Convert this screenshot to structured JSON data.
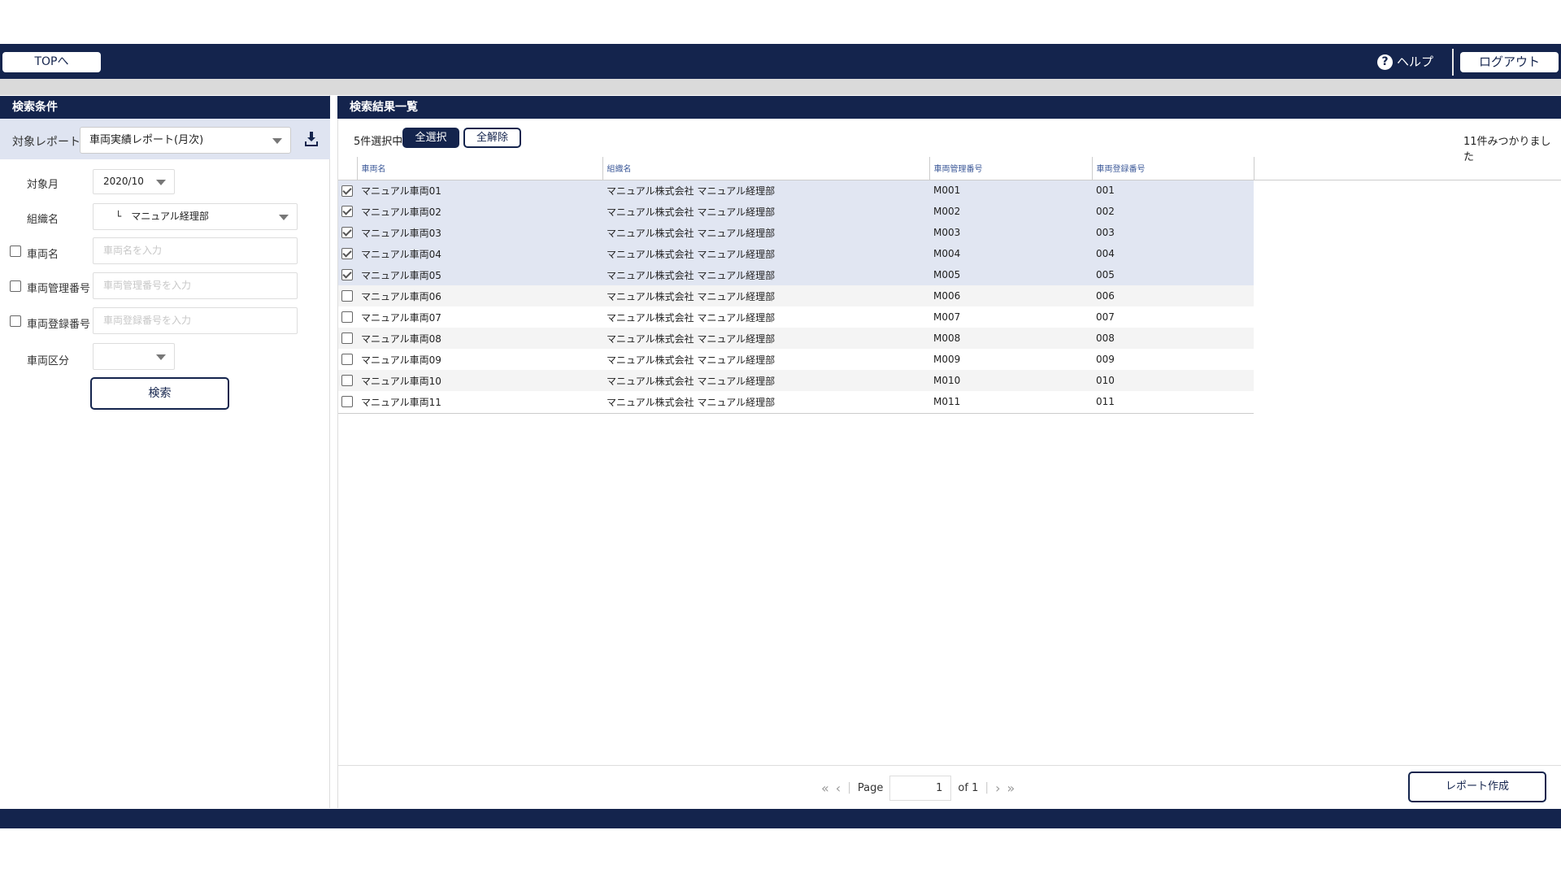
{
  "header": {
    "top_label": "TOPへ",
    "help_label": "ヘルプ",
    "logout_label": "ログアウト"
  },
  "search_panel": {
    "title": "検索条件",
    "report_label": "対象レポート",
    "report_value": "車両実績レポート(月次)",
    "month_label": "対象月",
    "month_value": "2020/10",
    "org_label": "組織名",
    "org_value": "└　マニュアル経理部",
    "vehicle_name_label": "車両名",
    "vehicle_name_placeholder": "車両名を入力",
    "mgmt_no_label": "車両管理番号",
    "mgmt_no_placeholder": "車両管理番号を入力",
    "reg_no_label": "車両登録番号",
    "reg_no_placeholder": "車両登録番号を入力",
    "category_label": "車両区分",
    "category_value": "",
    "search_button": "検索"
  },
  "results": {
    "title": "検索結果一覧",
    "selection_count": "5件選択中",
    "select_all": "全選択",
    "clear_all": "全解除",
    "found_count": "11件みつかりました",
    "columns": [
      "車両名",
      "組織名",
      "車両管理番号",
      "車両登録番号"
    ],
    "rows": [
      {
        "checked": true,
        "name": "マニュアル車両01",
        "org": "マニュアル株式会社 マニュアル経理部",
        "mgmt": "M001",
        "reg": "001"
      },
      {
        "checked": true,
        "name": "マニュアル車両02",
        "org": "マニュアル株式会社 マニュアル経理部",
        "mgmt": "M002",
        "reg": "002"
      },
      {
        "checked": true,
        "name": "マニュアル車両03",
        "org": "マニュアル株式会社 マニュアル経理部",
        "mgmt": "M003",
        "reg": "003"
      },
      {
        "checked": true,
        "name": "マニュアル車両04",
        "org": "マニュアル株式会社 マニュアル経理部",
        "mgmt": "M004",
        "reg": "004"
      },
      {
        "checked": true,
        "name": "マニュアル車両05",
        "org": "マニュアル株式会社 マニュアル経理部",
        "mgmt": "M005",
        "reg": "005"
      },
      {
        "checked": false,
        "name": "マニュアル車両06",
        "org": "マニュアル株式会社 マニュアル経理部",
        "mgmt": "M006",
        "reg": "006"
      },
      {
        "checked": false,
        "name": "マニュアル車両07",
        "org": "マニュアル株式会社 マニュアル経理部",
        "mgmt": "M007",
        "reg": "007"
      },
      {
        "checked": false,
        "name": "マニュアル車両08",
        "org": "マニュアル株式会社 マニュアル経理部",
        "mgmt": "M008",
        "reg": "008"
      },
      {
        "checked": false,
        "name": "マニュアル車両09",
        "org": "マニュアル株式会社 マニュアル経理部",
        "mgmt": "M009",
        "reg": "009"
      },
      {
        "checked": false,
        "name": "マニュアル車両10",
        "org": "マニュアル株式会社 マニュアル経理部",
        "mgmt": "M010",
        "reg": "010"
      },
      {
        "checked": false,
        "name": "マニュアル車両11",
        "org": "マニュアル株式会社 マニュアル経理部",
        "mgmt": "M011",
        "reg": "011"
      }
    ]
  },
  "pager": {
    "page_label": "Page",
    "page_value": "1",
    "of_label": "of 1"
  },
  "actions": {
    "report_create": "レポート作成"
  }
}
